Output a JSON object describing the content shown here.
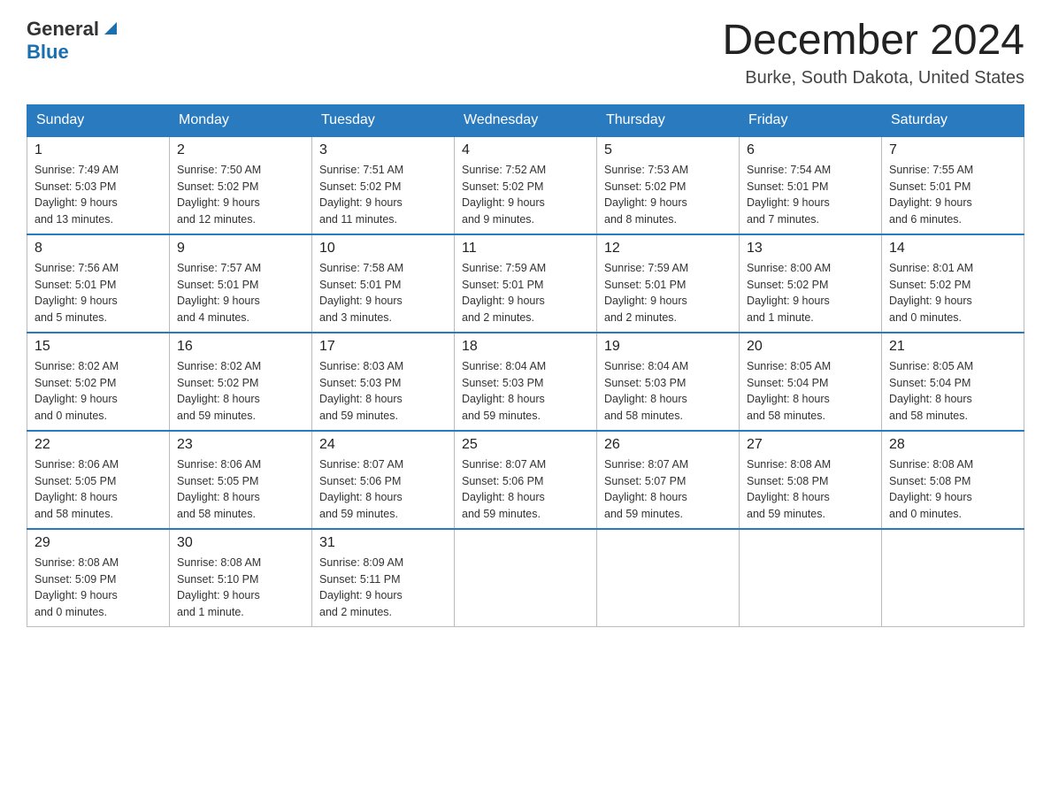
{
  "header": {
    "logo_general": "General",
    "logo_blue": "Blue",
    "month_title": "December 2024",
    "location": "Burke, South Dakota, United States"
  },
  "weekdays": [
    "Sunday",
    "Monday",
    "Tuesday",
    "Wednesday",
    "Thursday",
    "Friday",
    "Saturday"
  ],
  "weeks": [
    [
      {
        "day": "1",
        "sunrise": "7:49 AM",
        "sunset": "5:03 PM",
        "daylight": "9 hours and 13 minutes."
      },
      {
        "day": "2",
        "sunrise": "7:50 AM",
        "sunset": "5:02 PM",
        "daylight": "9 hours and 12 minutes."
      },
      {
        "day": "3",
        "sunrise": "7:51 AM",
        "sunset": "5:02 PM",
        "daylight": "9 hours and 11 minutes."
      },
      {
        "day": "4",
        "sunrise": "7:52 AM",
        "sunset": "5:02 PM",
        "daylight": "9 hours and 9 minutes."
      },
      {
        "day": "5",
        "sunrise": "7:53 AM",
        "sunset": "5:02 PM",
        "daylight": "9 hours and 8 minutes."
      },
      {
        "day": "6",
        "sunrise": "7:54 AM",
        "sunset": "5:01 PM",
        "daylight": "9 hours and 7 minutes."
      },
      {
        "day": "7",
        "sunrise": "7:55 AM",
        "sunset": "5:01 PM",
        "daylight": "9 hours and 6 minutes."
      }
    ],
    [
      {
        "day": "8",
        "sunrise": "7:56 AM",
        "sunset": "5:01 PM",
        "daylight": "9 hours and 5 minutes."
      },
      {
        "day": "9",
        "sunrise": "7:57 AM",
        "sunset": "5:01 PM",
        "daylight": "9 hours and 4 minutes."
      },
      {
        "day": "10",
        "sunrise": "7:58 AM",
        "sunset": "5:01 PM",
        "daylight": "9 hours and 3 minutes."
      },
      {
        "day": "11",
        "sunrise": "7:59 AM",
        "sunset": "5:01 PM",
        "daylight": "9 hours and 2 minutes."
      },
      {
        "day": "12",
        "sunrise": "7:59 AM",
        "sunset": "5:01 PM",
        "daylight": "9 hours and 2 minutes."
      },
      {
        "day": "13",
        "sunrise": "8:00 AM",
        "sunset": "5:02 PM",
        "daylight": "9 hours and 1 minute."
      },
      {
        "day": "14",
        "sunrise": "8:01 AM",
        "sunset": "5:02 PM",
        "daylight": "9 hours and 0 minutes."
      }
    ],
    [
      {
        "day": "15",
        "sunrise": "8:02 AM",
        "sunset": "5:02 PM",
        "daylight": "9 hours and 0 minutes."
      },
      {
        "day": "16",
        "sunrise": "8:02 AM",
        "sunset": "5:02 PM",
        "daylight": "8 hours and 59 minutes."
      },
      {
        "day": "17",
        "sunrise": "8:03 AM",
        "sunset": "5:03 PM",
        "daylight": "8 hours and 59 minutes."
      },
      {
        "day": "18",
        "sunrise": "8:04 AM",
        "sunset": "5:03 PM",
        "daylight": "8 hours and 59 minutes."
      },
      {
        "day": "19",
        "sunrise": "8:04 AM",
        "sunset": "5:03 PM",
        "daylight": "8 hours and 58 minutes."
      },
      {
        "day": "20",
        "sunrise": "8:05 AM",
        "sunset": "5:04 PM",
        "daylight": "8 hours and 58 minutes."
      },
      {
        "day": "21",
        "sunrise": "8:05 AM",
        "sunset": "5:04 PM",
        "daylight": "8 hours and 58 minutes."
      }
    ],
    [
      {
        "day": "22",
        "sunrise": "8:06 AM",
        "sunset": "5:05 PM",
        "daylight": "8 hours and 58 minutes."
      },
      {
        "day": "23",
        "sunrise": "8:06 AM",
        "sunset": "5:05 PM",
        "daylight": "8 hours and 58 minutes."
      },
      {
        "day": "24",
        "sunrise": "8:07 AM",
        "sunset": "5:06 PM",
        "daylight": "8 hours and 59 minutes."
      },
      {
        "day": "25",
        "sunrise": "8:07 AM",
        "sunset": "5:06 PM",
        "daylight": "8 hours and 59 minutes."
      },
      {
        "day": "26",
        "sunrise": "8:07 AM",
        "sunset": "5:07 PM",
        "daylight": "8 hours and 59 minutes."
      },
      {
        "day": "27",
        "sunrise": "8:08 AM",
        "sunset": "5:08 PM",
        "daylight": "8 hours and 59 minutes."
      },
      {
        "day": "28",
        "sunrise": "8:08 AM",
        "sunset": "5:08 PM",
        "daylight": "9 hours and 0 minutes."
      }
    ],
    [
      {
        "day": "29",
        "sunrise": "8:08 AM",
        "sunset": "5:09 PM",
        "daylight": "9 hours and 0 minutes."
      },
      {
        "day": "30",
        "sunrise": "8:08 AM",
        "sunset": "5:10 PM",
        "daylight": "9 hours and 1 minute."
      },
      {
        "day": "31",
        "sunrise": "8:09 AM",
        "sunset": "5:11 PM",
        "daylight": "9 hours and 2 minutes."
      },
      null,
      null,
      null,
      null
    ]
  ]
}
